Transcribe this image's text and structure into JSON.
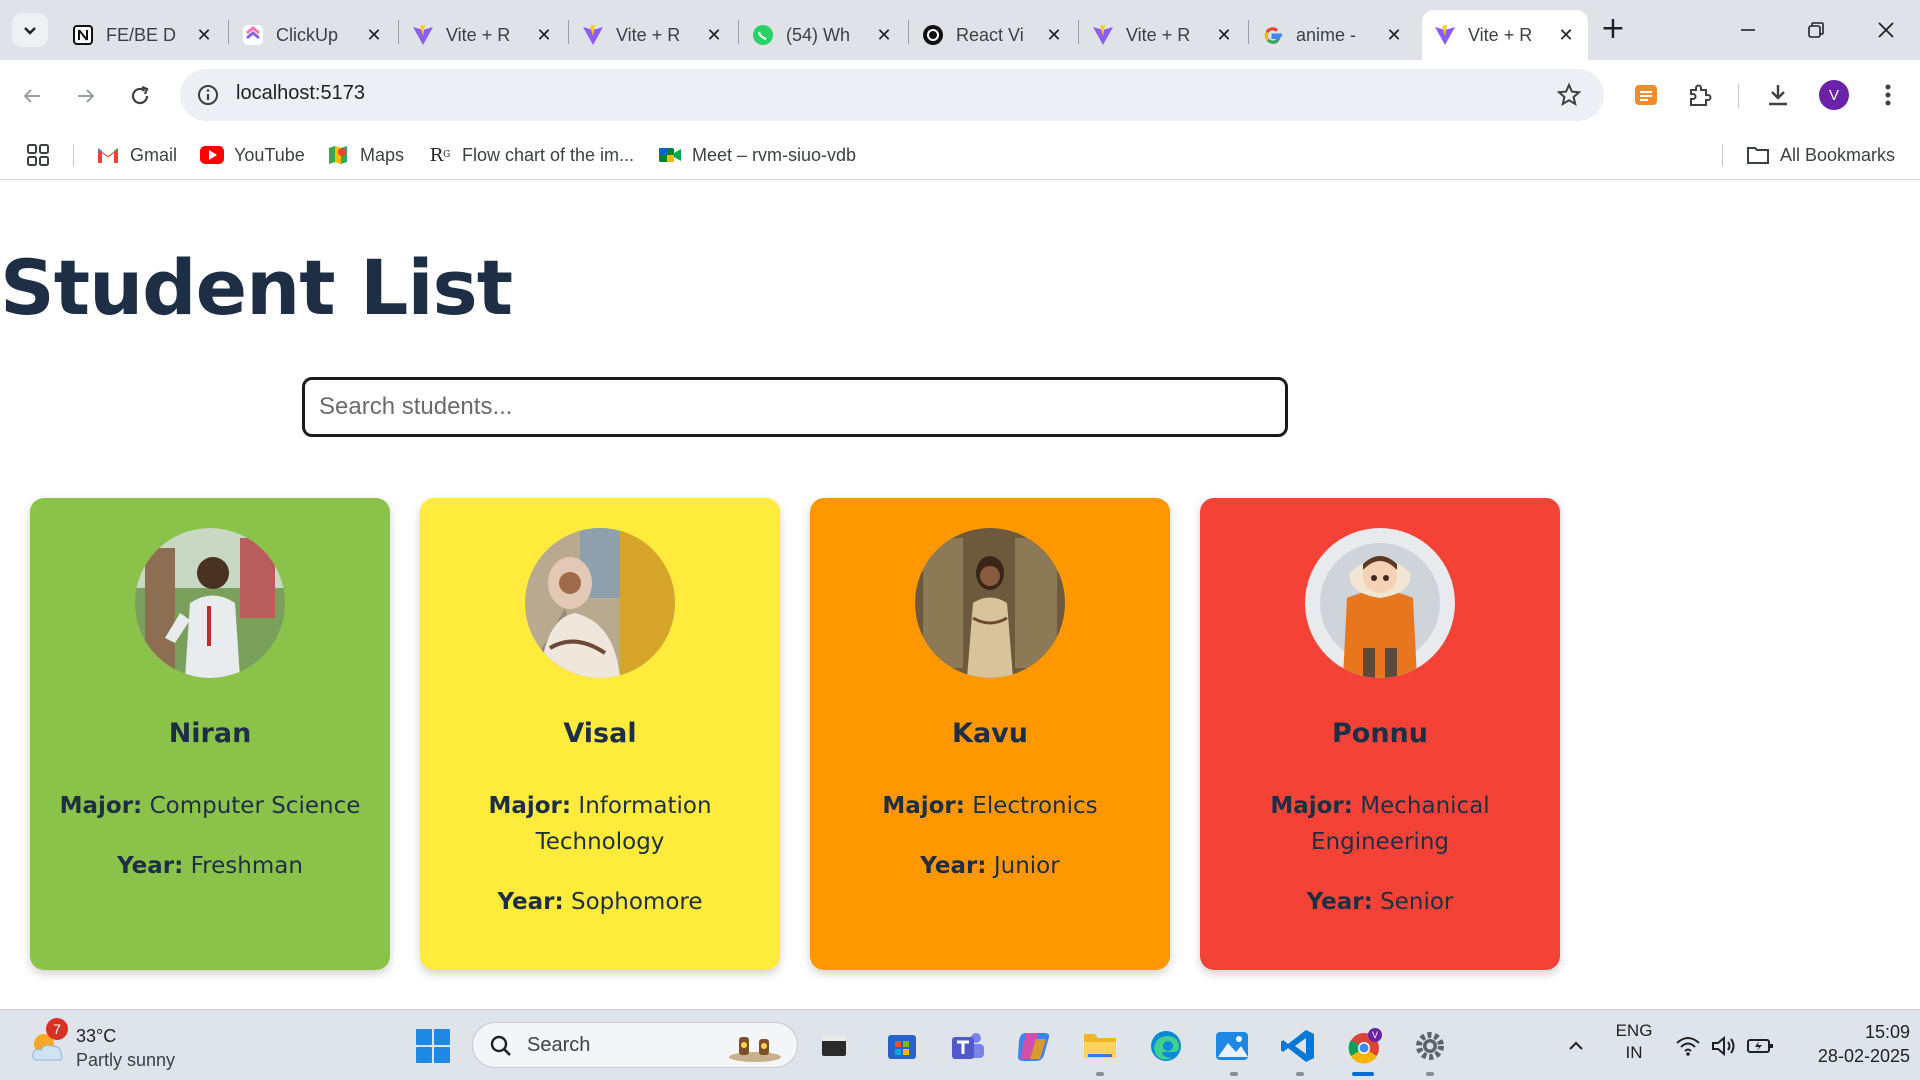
{
  "browser": {
    "tabs": [
      {
        "title": "FE/BE D",
        "icon": "notion-icon"
      },
      {
        "title": "ClickUp",
        "icon": "clickup-icon"
      },
      {
        "title": "Vite + R",
        "icon": "vite-icon"
      },
      {
        "title": "Vite + R",
        "icon": "vite-icon"
      },
      {
        "title": "(54) Wh",
        "icon": "whatsapp-icon"
      },
      {
        "title": "React Vi",
        "icon": "chatgpt-icon"
      },
      {
        "title": "Vite + R",
        "icon": "vite-icon"
      },
      {
        "title": "anime -",
        "icon": "google-icon"
      },
      {
        "title": "Vite + R",
        "icon": "vite-icon",
        "active": true
      }
    ],
    "url": "localhost:5173",
    "profile_initial": "V",
    "bookmarks": [
      {
        "label": "Gmail",
        "icon": "gmail-icon"
      },
      {
        "label": "YouTube",
        "icon": "youtube-icon"
      },
      {
        "label": "Maps",
        "icon": "maps-icon"
      },
      {
        "label": "Flow chart of the im...",
        "icon": "researchgate-icon"
      },
      {
        "label": "Meet – rvm-siuo-vdb",
        "icon": "meet-icon"
      }
    ],
    "all_bookmarks_label": "All Bookmarks"
  },
  "page": {
    "title": "Student List",
    "search_placeholder": "Search students...",
    "major_label": "Major:",
    "year_label": "Year:",
    "students": [
      {
        "name": "Niran",
        "major": "Computer Science",
        "year": "Freshman",
        "color": "#8bc34a"
      },
      {
        "name": "Visal",
        "major": "Information Technology",
        "year": "Sophomore",
        "color": "#ffeb3b"
      },
      {
        "name": "Kavu",
        "major": "Electronics",
        "year": "Junior",
        "color": "#ff9800"
      },
      {
        "name": "Ponnu",
        "major": "Mechanical Engineering",
        "year": "Senior",
        "color": "#f44336"
      }
    ]
  },
  "taskbar": {
    "weather_temp": "33°C",
    "weather_condition": "Partly sunny",
    "weather_badge": "7",
    "search_label": "Search",
    "lang_line1": "ENG",
    "lang_line2": "IN",
    "time": "15:09",
    "date": "28-02-2025"
  }
}
